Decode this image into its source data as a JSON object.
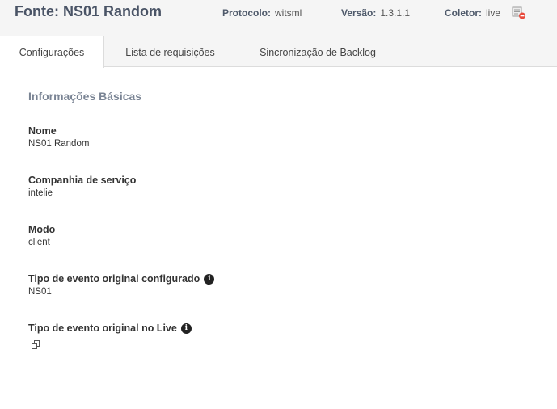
{
  "header": {
    "title": "Fonte: NS01 Random",
    "protocol": {
      "label": "Protocolo:",
      "value": "witsml"
    },
    "version": {
      "label": "Versão:",
      "value": "1.3.1.1"
    },
    "collector": {
      "label": "Coletor:",
      "value": "live",
      "icon": "remove-collector-icon"
    }
  },
  "tabs": [
    {
      "label": "Configurações",
      "active": true
    },
    {
      "label": "Lista de requisições",
      "active": false
    },
    {
      "label": "Sincronização de Backlog",
      "active": false
    }
  ],
  "main": {
    "section_title": "Informações Básicas",
    "fields": [
      {
        "label": "Nome",
        "value": "NS01 Random"
      },
      {
        "label": "Companhia de serviço",
        "value": "intelie"
      },
      {
        "label": "Modo",
        "value": "client"
      },
      {
        "label": "Tipo de evento original configurado",
        "value": "NS01",
        "icon": "info-icon"
      },
      {
        "label": "Tipo de evento original no Live",
        "value": "",
        "icon": "info-icon",
        "action_icon": "copy-icon"
      }
    ]
  },
  "colors": {
    "header_bg": "#f5f5f5",
    "title": "#4a5466",
    "section_title": "#7a8494",
    "collector_icon_red": "#e84a3c"
  }
}
